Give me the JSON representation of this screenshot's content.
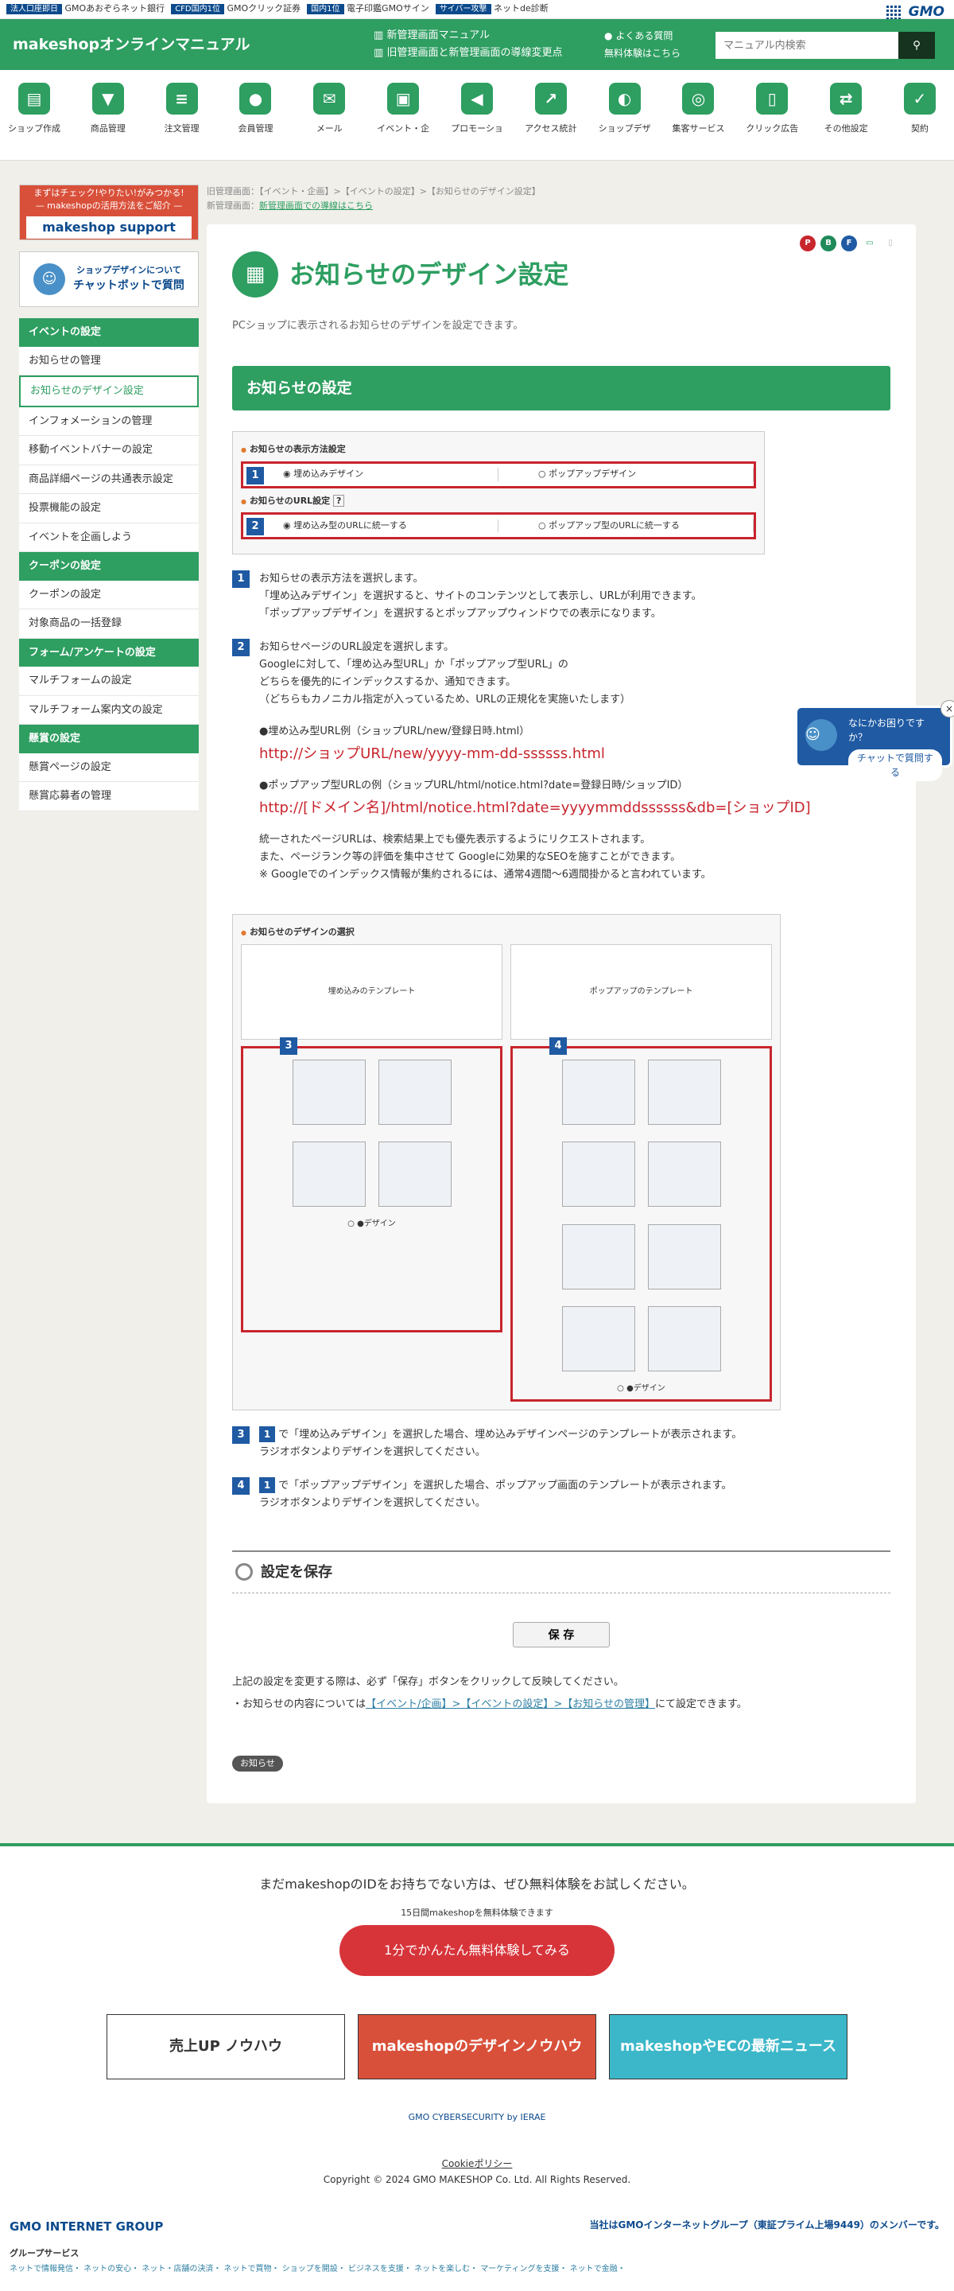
{
  "topbar": {
    "items": [
      {
        "tag": "法人口座即日",
        "text": "GMOあおぞらネット銀行"
      },
      {
        "tag": "CFD国内1位",
        "text": "GMOクリック証券"
      },
      {
        "tag": "国内1位",
        "text": "電子印鑑GMOサイン"
      },
      {
        "tag": "サイバー攻撃",
        "text": "ネットde診断"
      }
    ],
    "gmo": "GMO"
  },
  "header": {
    "brand": "makeshopオンラインマニュアル",
    "link1": "新管理画面マニュアル",
    "link2": "旧管理画面と新管理画面の導線変更点",
    "faq": "よくある質問",
    "trial": "無料体験はこちら",
    "search_placeholder": "マニュアル内検索"
  },
  "nav": [
    {
      "label": "ショップ作成",
      "icon": "shop-icon",
      "glyph": "▤"
    },
    {
      "label": "商品管理",
      "icon": "basket-icon",
      "glyph": "▼"
    },
    {
      "label": "注文管理",
      "icon": "clipboard-icon",
      "glyph": "≡"
    },
    {
      "label": "会員管理",
      "icon": "members-icon",
      "glyph": "●"
    },
    {
      "label": "メール",
      "icon": "mail-icon",
      "glyph": "✉"
    },
    {
      "label": "イベント・企",
      "icon": "event-icon",
      "glyph": "▣"
    },
    {
      "label": "プロモーショ",
      "icon": "megaphone-icon",
      "glyph": "◀"
    },
    {
      "label": "アクセス統計",
      "icon": "chart-icon",
      "glyph": "↗"
    },
    {
      "label": "ショップデザ",
      "icon": "palette-icon",
      "glyph": "◐"
    },
    {
      "label": "集客サービス",
      "icon": "globe-icon",
      "glyph": "◎"
    },
    {
      "label": "クリック広告",
      "icon": "mouse-icon",
      "glyph": "▯"
    },
    {
      "label": "その他設定",
      "icon": "swap-icon",
      "glyph": "⇄"
    },
    {
      "label": "契約",
      "icon": "contract-icon",
      "glyph": "✓"
    }
  ],
  "sidebar": {
    "banner1_top": "まずはチェック!やりたい!がみつかる!",
    "banner1_sub": "— makeshopの活用方法をご紹介 —",
    "banner1_logo": "makeshop support",
    "banner2_top": "ショップデザインについて",
    "banner2_main": "チャットボットで質問",
    "groups": [
      {
        "title": "イベントの設定",
        "items": [
          "お知らせの管理",
          "お知らせのデザイン設定",
          "インフォメーションの管理",
          "移動イベントバナーの設定",
          "商品詳細ページの共通表示設定",
          "投票機能の設定",
          "イベントを企画しよう"
        ]
      },
      {
        "title": "クーポンの設定",
        "items": [
          "クーポンの設定",
          "対象商品の一括登録"
        ]
      },
      {
        "title": "フォーム/アンケートの設定",
        "items": [
          "マルチフォームの設定",
          "マルチフォーム案内文の設定"
        ]
      },
      {
        "title": "懸賞の設定",
        "items": [
          "懸賞ページの設定",
          "懸賞応募者の管理"
        ]
      }
    ]
  },
  "breadcrumb": {
    "line1": "旧管理画面：【イベント・企画】>【イベントの設定】>【お知らせのデザイン設定】",
    "line2_prefix": "新管理画面：",
    "line2_link": "新管理画面での導線はこちら"
  },
  "page": {
    "title": "お知らせのデザイン設定",
    "description": "PCショップに表示されるお知らせのデザインを設定できます。",
    "section": "お知らせの設定",
    "badges": [
      "P",
      "B",
      "F"
    ],
    "shot1": {
      "label1": "お知らせの表示方法設定",
      "opt1a": "◉ 埋め込みデザイン",
      "opt1b": "○ ポップアップデザイン",
      "label2": "お知らせのURL設定",
      "help": "?",
      "opt2a": "◉ 埋め込み型のURLに統一する",
      "opt2b": "○ ポップアップ型のURLに統一する"
    },
    "step1": {
      "num": "1",
      "line1": "お知らせの表示方法を選択します。",
      "line2": "「埋め込みデザイン」を選択すると、サイトのコンテンツとして表示し、URLが利用できます。",
      "line3": "「ポップアップデザイン」を選択するとポップアップウィンドウでの表示になります。"
    },
    "step2": {
      "num": "2",
      "line1": "お知らせページのURL設定を選択します。",
      "line2": "Googleに対して、「埋め込み型URL」か「ポップアップ型URL」の",
      "line3": "どちらを優先的にインデックスするか、通知できます。",
      "line4": "（どちらもカノニカル指定が入っているため、URLの正規化を実施いたします）",
      "ex1_label": "●埋め込み型URL例（ショップURL/new/登録日時.html）",
      "ex1_url": "http://ショップURL/new/yyyy-mm-dd-ssssss.html",
      "ex2_label": "●ポップアップ型URLの例（ショップURL/html/notice.html?date=登録日時/ショップID）",
      "ex2_url": "http://[ドメイン名]/html/notice.html?date=yyyymmddssssss&db=[ショップID]",
      "note1": "統一されたページURLは、検索結果上でも優先表示するようにリクエストされます。",
      "note2": "また、ページランク等の評価を集中させて Googleに効果的なSEOを施すことができます。",
      "note3": "※ Googleでのインデックス情報が集約されるには、通常4週間〜6週間掛かると言われています。"
    },
    "shot2": {
      "label": "お知らせのデザインの選択",
      "left_title": "埋め込みのテンプレート",
      "right_title": "ポップアップのテンプレート",
      "num3": "3",
      "num4": "4",
      "design_label": "○ ●デザイン"
    },
    "step3": {
      "num": "3",
      "ref": "1",
      "line1": "で「埋め込みデザイン」を選択した場合、埋め込みデザインページのテンプレートが表示されます。",
      "line2": "ラジオボタンよりデザインを選択してください。"
    },
    "step4": {
      "num": "4",
      "ref": "1",
      "line1": "で「ポップアップデザイン」を選択した場合、ポップアップ画面のテンプレートが表示されます。",
      "line2": "ラジオボタンよりデザインを選択してください。"
    },
    "save_heading": "設定を保存",
    "save_button": "保 存",
    "save_note": "上記の設定を変更する際は、必ず「保存」ボタンをクリックして反映してください。",
    "link_prefix": "・お知らせの内容については",
    "link_text": "【イベント/企画】>【イベントの設定】>【お知らせの管理】",
    "link_suffix": "にて設定できます。",
    "tag": "お知らせ"
  },
  "chat": {
    "line1": "なにかお困りですか？",
    "button": "チャットで質問する"
  },
  "footer": {
    "message": "まだmakeshopのIDをお持ちでない方は、ぜひ無料体験をお試しください。",
    "sub": "15日間makeshopを無料体験できます",
    "trial_button": "1分でかんたん無料体験してみる",
    "banner1": "売上UP ノウハウ",
    "banner2": "makeshopのデザインノウハウ",
    "banner3": "makeshopやECの最新ニュース",
    "security": "GMO CYBERSECURITY by IERAE",
    "cookie": "Cookieポリシー",
    "copyright": "Copyright © 2024 GMO MAKESHOP Co. Ltd. All Rights Reserved.",
    "group_logo": "GMO INTERNET GROUP",
    "group_member": "当社はGMOインターネットグループ（東証プライム上場9449）のメンバーです。",
    "group_services": "グループサービス",
    "group_links": "ネットで情報発信・ ネットの安心・ ネット・店舗の決済・ ネットで買物・ ショップを開設・ ビジネスを支援・ ネットを楽しむ・ マーケティングを支援・ ネットで金融・"
  },
  "colors": {
    "brand": "#2e9e61",
    "accent": "#c8252d",
    "navy": "#1f5aa3"
  }
}
